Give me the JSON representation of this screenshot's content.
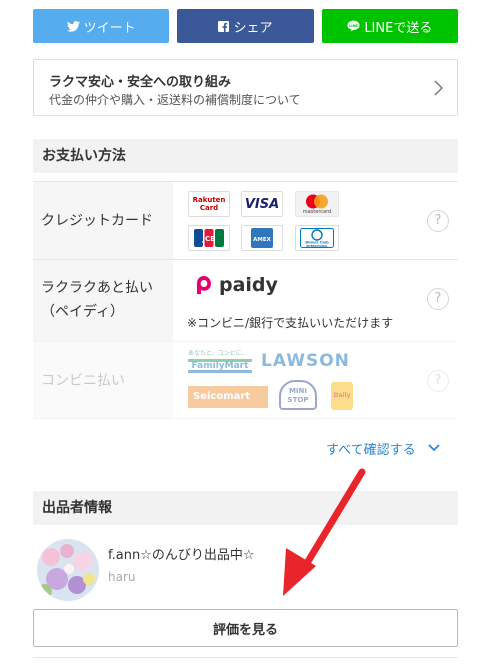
{
  "share": {
    "twitter_label": "ツイート",
    "facebook_label": "シェア",
    "line_label": "LINEで送る"
  },
  "safety": {
    "title": "ラクマ安心・安全への取り組み",
    "subtitle": "代金の仲介や購入・返送料の補償制度について"
  },
  "payment": {
    "heading": "お支払い方法",
    "credit_label": "クレジットカード",
    "paidy_label_1": "ラクラクあと払い",
    "paidy_label_2": "（ペイディ）",
    "paidy_brand": "paidy",
    "paidy_note": "※コンビニ/銀行で支払いいただけます",
    "conv_label": "コンビニ払い",
    "help": "?",
    "card_logos": {
      "rakuten_1": "Rakuten",
      "rakuten_2": "Card",
      "visa": "VISA",
      "mastercard": "mastercard",
      "jcb": "JCB",
      "amex": "AMEX",
      "diners_1": "Diners Club",
      "diners_2": "INTERNATIONAL"
    },
    "store_logos": {
      "familymart_tag": "あなたと、コンビに、",
      "familymart": "FamilyMart",
      "lawson": "LAWSON",
      "seicomart": "Seicomart",
      "ministop_1": "MINI",
      "ministop_2": "STOP",
      "daily": "Daily"
    },
    "see_all": "すべて確認する"
  },
  "seller": {
    "heading": "出品者情報",
    "name": "f.ann☆のんびり出品中☆",
    "id": "haru",
    "rating_button": "評価を見る"
  },
  "colors": {
    "twitter": "#55acee",
    "facebook": "#3b5998",
    "line": "#00c300",
    "link": "#2a86d6",
    "arrow": "#e8252b",
    "paidy": "#e5006e"
  }
}
